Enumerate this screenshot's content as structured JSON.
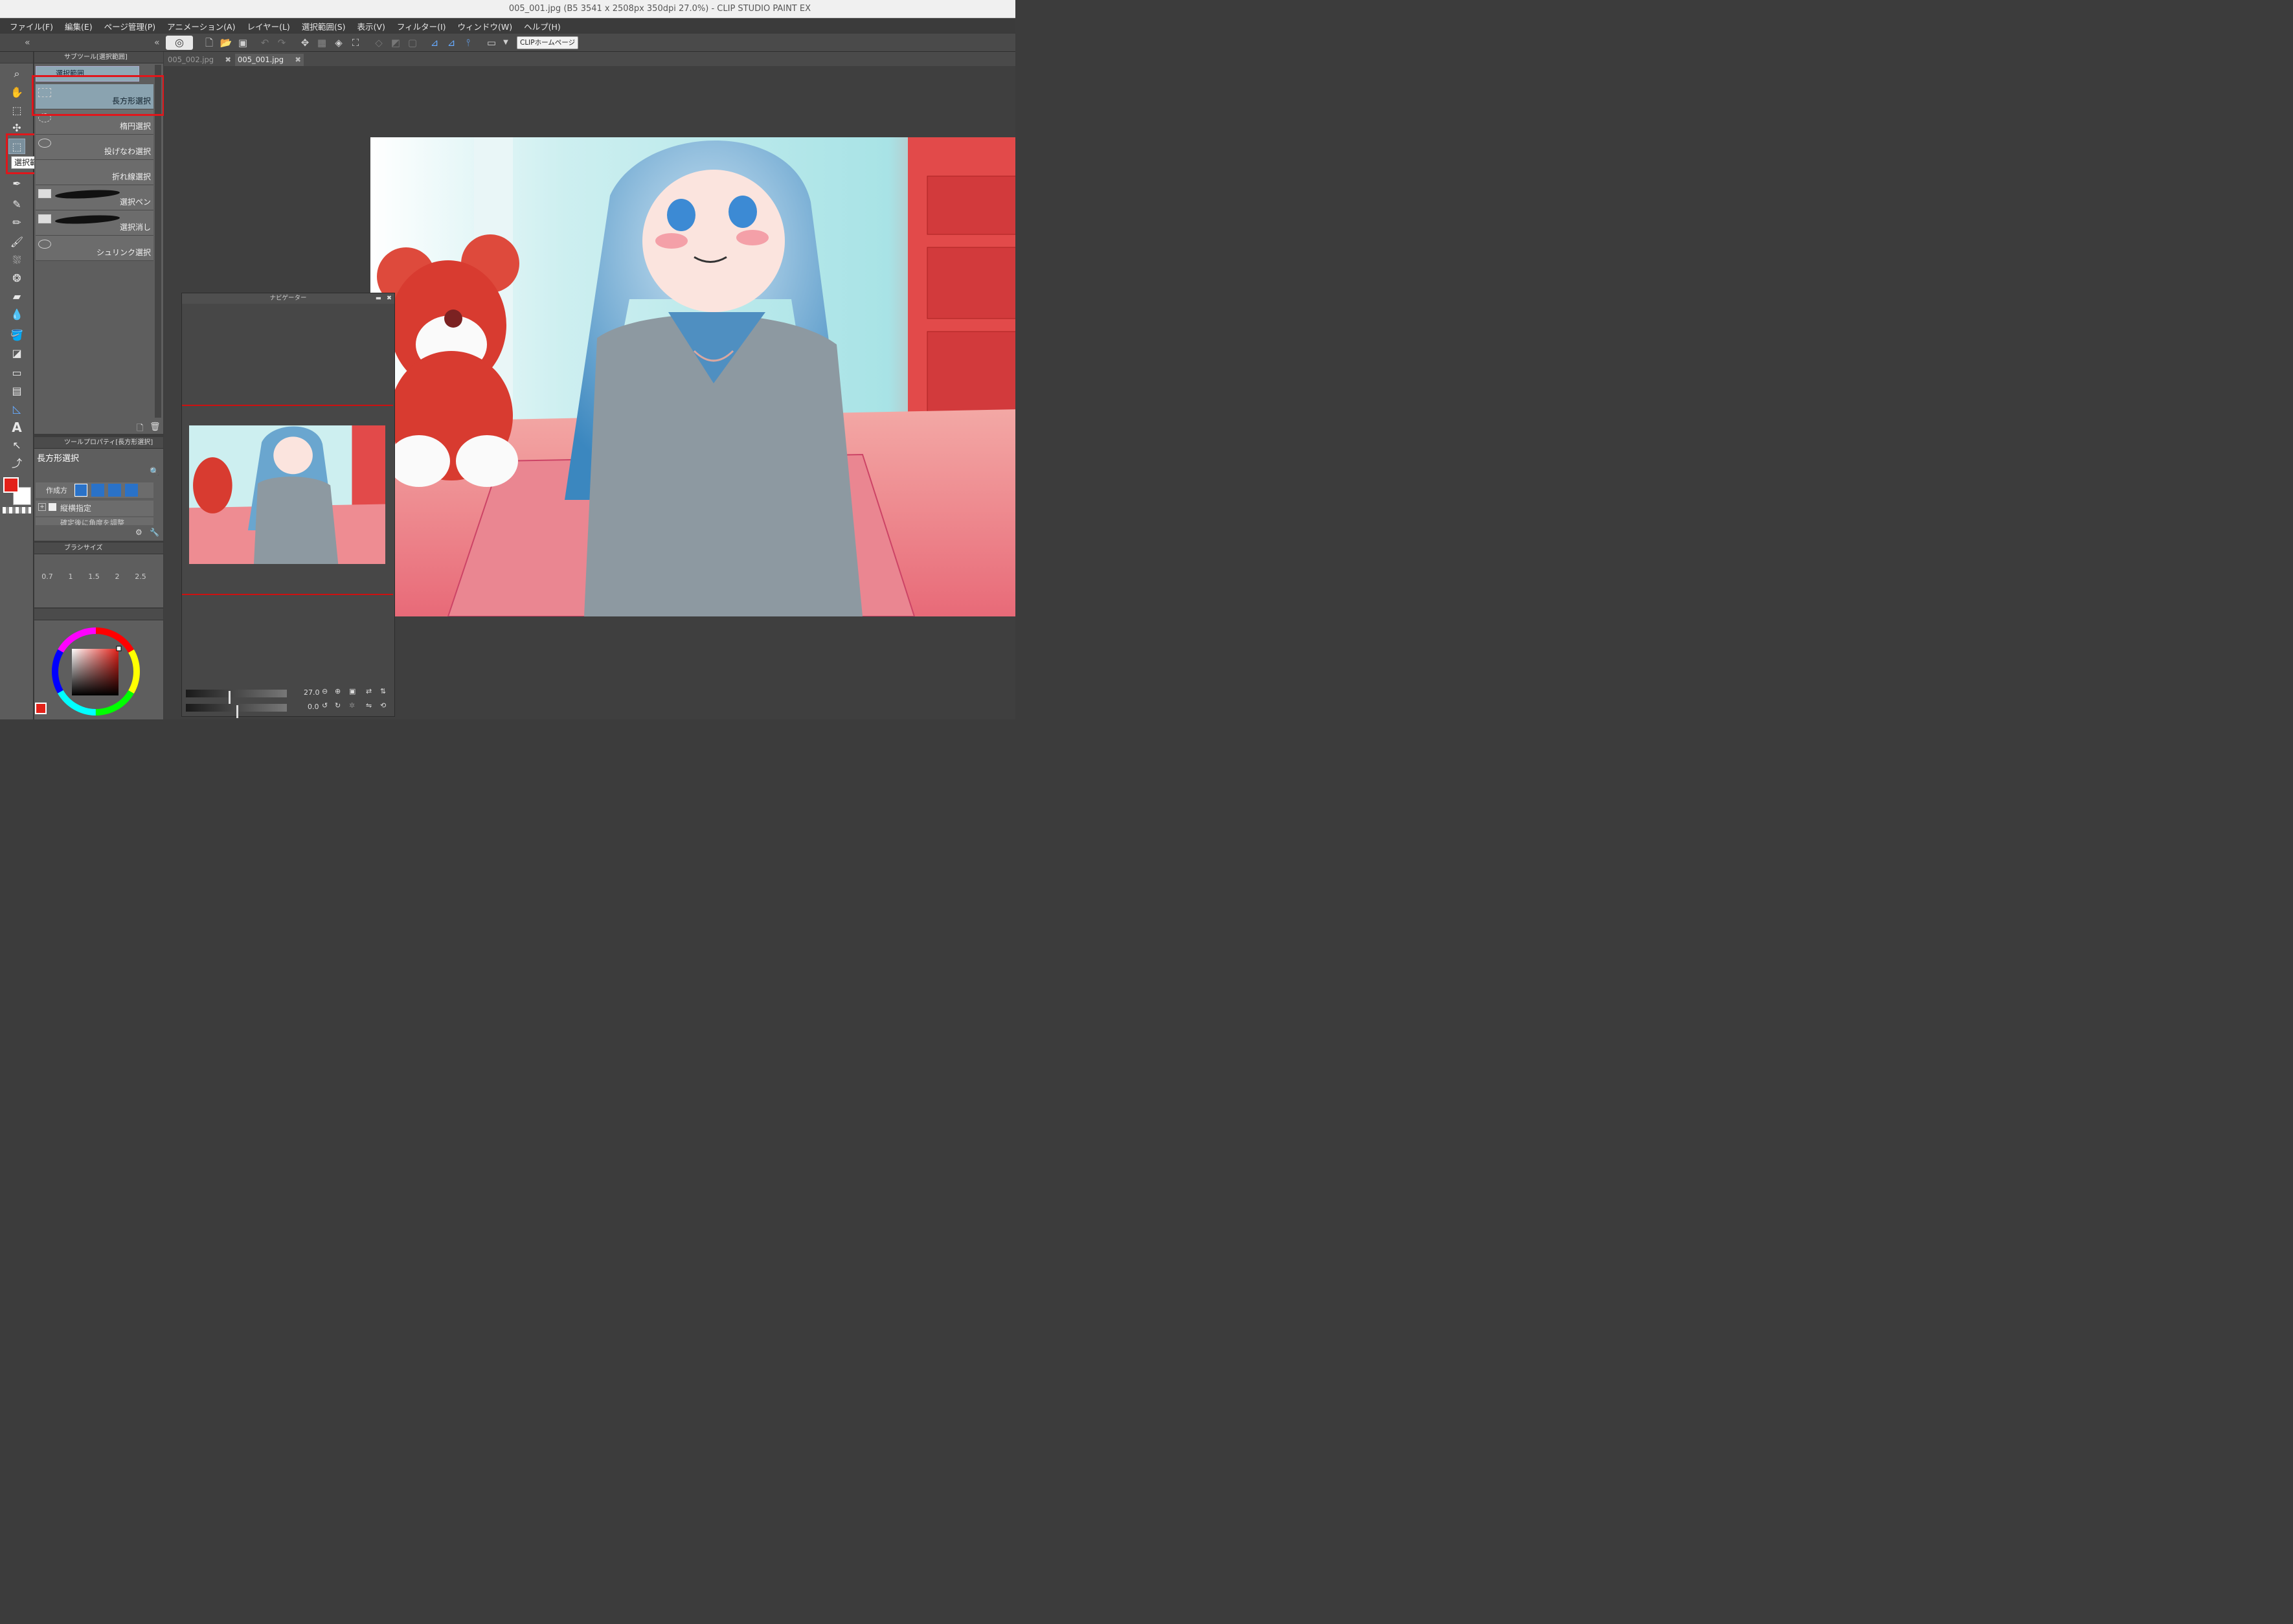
{
  "window": {
    "title": "005_001.jpg (B5 3541 x 2508px 350dpi 27.0%)  - CLIP STUDIO PAINT EX"
  },
  "menu": [
    "ファイル(F)",
    "編集(E)",
    "ページ管理(P)",
    "アニメーション(A)",
    "レイヤー(L)",
    "選択範囲(S)",
    "表示(V)",
    "フィルター(I)",
    "ウィンドウ(W)",
    "ヘルプ(H)"
  ],
  "command_bar": {
    "home_button": "CLIPホームページ"
  },
  "tool_tooltip": "選択範囲(M)",
  "sub_tool": {
    "header": "サブツール[選択範囲]",
    "group": "選択範囲",
    "items": [
      {
        "label": "長方形選択",
        "selected": true,
        "icon": "rect-select-icon"
      },
      {
        "label": "楕円選択",
        "icon": "ellipse-select-icon"
      },
      {
        "label": "投げなわ選択",
        "icon": "lasso-icon"
      },
      {
        "label": "折れ線選択",
        "icon": "polyline-icon"
      },
      {
        "label": "選択ペン",
        "icon": "brush-stroke-icon"
      },
      {
        "label": "選択消し",
        "icon": "brush-stroke-icon"
      },
      {
        "label": "シュリンク選択",
        "icon": "lasso-icon"
      }
    ]
  },
  "tool_property": {
    "header": "ツールプロパティ[長方形選択]",
    "name": "長方形選択",
    "creation_label": "作成方",
    "aspect_label": "縦横指定",
    "cut_label": "確定後に角度を調整"
  },
  "brush_size": {
    "header": "ブラシサイズ",
    "values": [
      "0.7",
      "1",
      "1.5",
      "2",
      "2.5"
    ]
  },
  "colors": {
    "foreground": "#e32119",
    "background": "#ffffff",
    "highlight": "#e0161b"
  },
  "tabs": [
    {
      "label": "005_002.jpg",
      "active": false
    },
    {
      "label": "005_001.jpg",
      "active": true
    }
  ],
  "navigator": {
    "title": "ナビゲーター",
    "zoom": "27.0",
    "rotation": "0.0"
  }
}
